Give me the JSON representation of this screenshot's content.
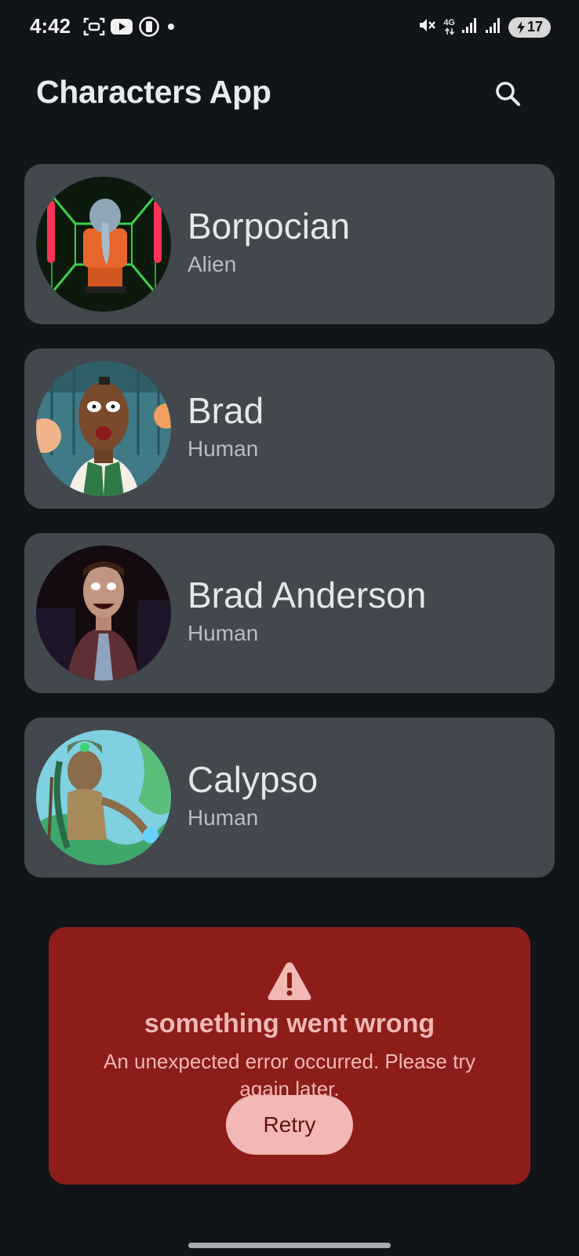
{
  "status_bar": {
    "time": "4:42",
    "left_icons": [
      "screenshot-icon",
      "youtube-icon",
      "app-notification-icon",
      "dot-icon"
    ],
    "network_label": "4G",
    "battery_level": "17",
    "battery_charging": true
  },
  "app_bar": {
    "title": "Characters App",
    "search_icon": "search-icon"
  },
  "characters": [
    {
      "name": "Borpocian",
      "species": "Alien"
    },
    {
      "name": "Brad",
      "species": "Human"
    },
    {
      "name": "Brad Anderson",
      "species": "Human"
    },
    {
      "name": "Calypso",
      "species": "Human"
    }
  ],
  "error": {
    "icon": "warning-icon",
    "title": "something went wrong",
    "message": "An unexpected error occurred. Please try again later.",
    "retry_label": "Retry"
  },
  "colors": {
    "background": "#111418",
    "card": "#43474e",
    "error_container": "#8c1d18",
    "on_error_container": "#f2b8b5",
    "retry_text": "#601410"
  }
}
